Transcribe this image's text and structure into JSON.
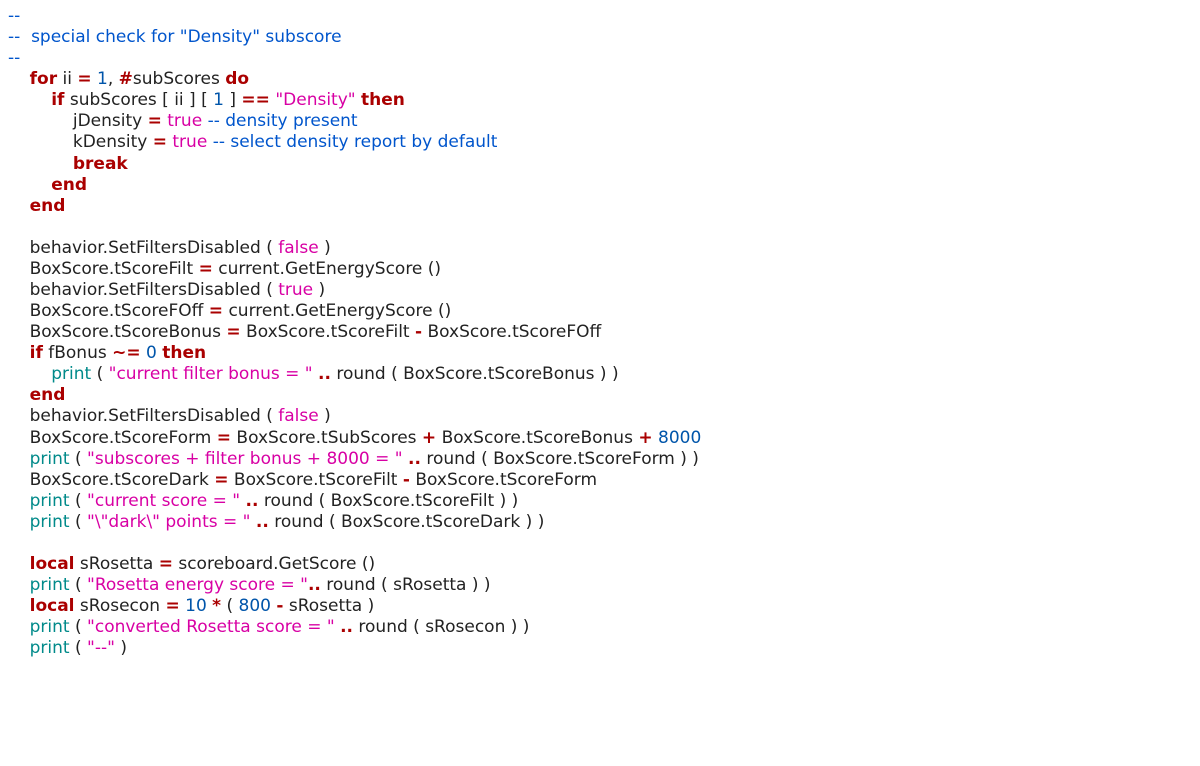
{
  "lines": [
    [
      {
        "c": "cmt",
        "t": "--"
      }
    ],
    [
      {
        "c": "cmt",
        "t": "--  special check for \"Density\" subscore"
      }
    ],
    [
      {
        "c": "cmt",
        "t": "--"
      }
    ],
    [
      {
        "t": "    "
      },
      {
        "c": "kw",
        "t": "for"
      },
      {
        "t": " ii "
      },
      {
        "c": "op",
        "t": "="
      },
      {
        "t": " "
      },
      {
        "c": "num",
        "t": "1"
      },
      {
        "t": ", "
      },
      {
        "c": "op",
        "t": "#"
      },
      {
        "t": "subScores "
      },
      {
        "c": "kw",
        "t": "do"
      }
    ],
    [
      {
        "t": "        "
      },
      {
        "c": "kw",
        "t": "if"
      },
      {
        "t": " subScores [ ii ] [ "
      },
      {
        "c": "num",
        "t": "1"
      },
      {
        "t": " ] "
      },
      {
        "c": "op",
        "t": "=="
      },
      {
        "t": " "
      },
      {
        "c": "str",
        "t": "\"Density\""
      },
      {
        "t": " "
      },
      {
        "c": "kw",
        "t": "then"
      }
    ],
    [
      {
        "t": "            jDensity "
      },
      {
        "c": "op",
        "t": "="
      },
      {
        "t": " "
      },
      {
        "c": "bool",
        "t": "true"
      },
      {
        "t": " "
      },
      {
        "c": "cmt",
        "t": "-- density present"
      }
    ],
    [
      {
        "t": "            kDensity "
      },
      {
        "c": "op",
        "t": "="
      },
      {
        "t": " "
      },
      {
        "c": "bool",
        "t": "true"
      },
      {
        "t": " "
      },
      {
        "c": "cmt",
        "t": "-- select density report by default"
      }
    ],
    [
      {
        "t": "            "
      },
      {
        "c": "kw",
        "t": "break"
      }
    ],
    [
      {
        "t": "        "
      },
      {
        "c": "kw",
        "t": "end"
      }
    ],
    [
      {
        "t": "    "
      },
      {
        "c": "kw",
        "t": "end"
      }
    ],
    [
      {
        "t": " "
      }
    ],
    [
      {
        "t": "    behavior.SetFiltersDisabled ( "
      },
      {
        "c": "bool",
        "t": "false"
      },
      {
        "t": " )"
      }
    ],
    [
      {
        "t": "    BoxScore.tScoreFilt "
      },
      {
        "c": "op",
        "t": "="
      },
      {
        "t": " current.GetEnergyScore ()"
      }
    ],
    [
      {
        "t": "    behavior.SetFiltersDisabled ( "
      },
      {
        "c": "bool",
        "t": "true"
      },
      {
        "t": " )"
      }
    ],
    [
      {
        "t": "    BoxScore.tScoreFOff "
      },
      {
        "c": "op",
        "t": "="
      },
      {
        "t": " current.GetEnergyScore ()"
      }
    ],
    [
      {
        "t": "    BoxScore.tScoreBonus "
      },
      {
        "c": "op",
        "t": "="
      },
      {
        "t": " BoxScore.tScoreFilt "
      },
      {
        "c": "op",
        "t": "-"
      },
      {
        "t": " BoxScore.tScoreFOff"
      }
    ],
    [
      {
        "t": "    "
      },
      {
        "c": "kw",
        "t": "if"
      },
      {
        "t": " fBonus "
      },
      {
        "c": "op",
        "t": "~="
      },
      {
        "t": " "
      },
      {
        "c": "num",
        "t": "0"
      },
      {
        "t": " "
      },
      {
        "c": "kw",
        "t": "then"
      }
    ],
    [
      {
        "t": "        "
      },
      {
        "c": "fnc",
        "t": "print"
      },
      {
        "t": " ( "
      },
      {
        "c": "str",
        "t": "\"current filter bonus = \""
      },
      {
        "t": " "
      },
      {
        "c": "op",
        "t": ".."
      },
      {
        "t": " round ( BoxScore.tScoreBonus ) )"
      }
    ],
    [
      {
        "t": "    "
      },
      {
        "c": "kw",
        "t": "end"
      }
    ],
    [
      {
        "t": "    behavior.SetFiltersDisabled ( "
      },
      {
        "c": "bool",
        "t": "false"
      },
      {
        "t": " )"
      }
    ],
    [
      {
        "t": "    BoxScore.tScoreForm "
      },
      {
        "c": "op",
        "t": "="
      },
      {
        "t": " BoxScore.tSubScores "
      },
      {
        "c": "op",
        "t": "+"
      },
      {
        "t": " BoxScore.tScoreBonus "
      },
      {
        "c": "op",
        "t": "+"
      },
      {
        "t": " "
      },
      {
        "c": "num",
        "t": "8000"
      }
    ],
    [
      {
        "t": "    "
      },
      {
        "c": "fnc",
        "t": "print"
      },
      {
        "t": " ( "
      },
      {
        "c": "str",
        "t": "\"subscores + filter bonus + 8000 = \""
      },
      {
        "t": " "
      },
      {
        "c": "op",
        "t": ".."
      },
      {
        "t": " round ( BoxScore.tScoreForm ) )"
      }
    ],
    [
      {
        "t": "    BoxScore.tScoreDark "
      },
      {
        "c": "op",
        "t": "="
      },
      {
        "t": " BoxScore.tScoreFilt "
      },
      {
        "c": "op",
        "t": "-"
      },
      {
        "t": " BoxScore.tScoreForm"
      }
    ],
    [
      {
        "t": "    "
      },
      {
        "c": "fnc",
        "t": "print"
      },
      {
        "t": " ( "
      },
      {
        "c": "str",
        "t": "\"current score = \""
      },
      {
        "t": " "
      },
      {
        "c": "op",
        "t": ".."
      },
      {
        "t": " round ( BoxScore.tScoreFilt ) )"
      }
    ],
    [
      {
        "t": "    "
      },
      {
        "c": "fnc",
        "t": "print"
      },
      {
        "t": " ( "
      },
      {
        "c": "str",
        "t": "\"\\\"dark\\\" points = \""
      },
      {
        "t": " "
      },
      {
        "c": "op",
        "t": ".."
      },
      {
        "t": " round ( BoxScore.tScoreDark ) )"
      }
    ],
    [
      {
        "t": " "
      }
    ],
    [
      {
        "t": "    "
      },
      {
        "c": "kw",
        "t": "local"
      },
      {
        "t": " sRosetta "
      },
      {
        "c": "op",
        "t": "="
      },
      {
        "t": " scoreboard.GetScore ()"
      }
    ],
    [
      {
        "t": "    "
      },
      {
        "c": "fnc",
        "t": "print"
      },
      {
        "t": " ( "
      },
      {
        "c": "str",
        "t": "\"Rosetta energy score = \""
      },
      {
        "c": "op",
        "t": ".."
      },
      {
        "t": " round ( sRosetta ) )"
      }
    ],
    [
      {
        "t": "    "
      },
      {
        "c": "kw",
        "t": "local"
      },
      {
        "t": " sRosecon "
      },
      {
        "c": "op",
        "t": "="
      },
      {
        "t": " "
      },
      {
        "c": "num",
        "t": "10"
      },
      {
        "t": " "
      },
      {
        "c": "op",
        "t": "*"
      },
      {
        "t": " ( "
      },
      {
        "c": "num",
        "t": "800"
      },
      {
        "t": " "
      },
      {
        "c": "op",
        "t": "-"
      },
      {
        "t": " sRosetta )"
      }
    ],
    [
      {
        "t": "    "
      },
      {
        "c": "fnc",
        "t": "print"
      },
      {
        "t": " ( "
      },
      {
        "c": "str",
        "t": "\"converted Rosetta score = \""
      },
      {
        "t": " "
      },
      {
        "c": "op",
        "t": ".."
      },
      {
        "t": " round ( sRosecon ) )"
      }
    ],
    [
      {
        "t": "    "
      },
      {
        "c": "fnc",
        "t": "print"
      },
      {
        "t": " ( "
      },
      {
        "c": "str",
        "t": "\"--\""
      },
      {
        "t": " )"
      }
    ]
  ]
}
